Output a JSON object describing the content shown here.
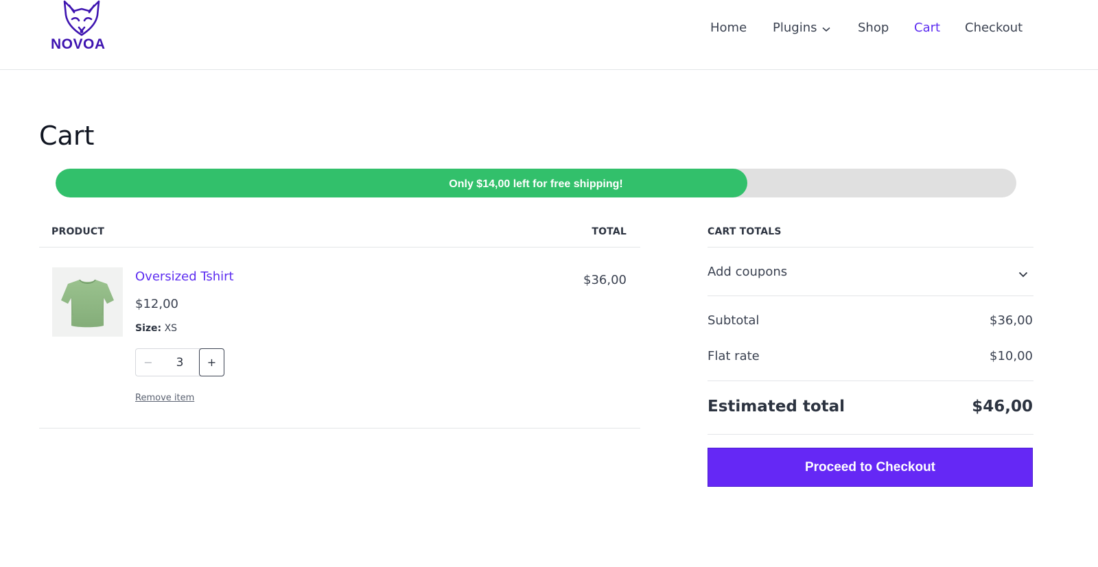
{
  "brand": {
    "name": "NOVOA",
    "color": "#3e14b0"
  },
  "nav": {
    "home": "Home",
    "plugins": "Plugins",
    "shop": "Shop",
    "cart": "Cart",
    "checkout": "Checkout"
  },
  "page": {
    "title": "Cart"
  },
  "shipping_progress": {
    "message": "Only $14,00 left for free shipping!",
    "percent": 72,
    "fill_color": "#32c06b",
    "track_color": "#e0e0e0"
  },
  "table": {
    "product_header": "PRODUCT",
    "total_header": "TOTAL"
  },
  "items": [
    {
      "name": "Oversized Tshirt",
      "price": "$12,00",
      "size_label": "Size:",
      "size_value": "XS",
      "quantity": "3",
      "minus": "−",
      "plus": "+",
      "remove_label": "Remove item",
      "line_total": "$36,00"
    }
  ],
  "totals": {
    "header": "CART TOTALS",
    "coupon_label": "Add coupons",
    "subtotal_label": "Subtotal",
    "subtotal_value": "$36,00",
    "flat_rate_label": "Flat rate",
    "flat_rate_value": "$10,00",
    "estimated_label": "Estimated total",
    "estimated_value": "$46,00",
    "checkout_button": "Proceed to Checkout"
  },
  "colors": {
    "accent": "#5c2cf0",
    "button": "#6528f5"
  }
}
